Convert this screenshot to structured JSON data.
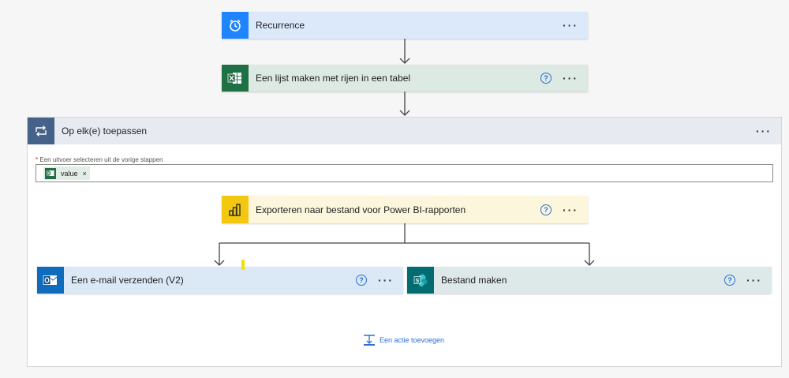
{
  "steps": {
    "recurrence": {
      "title": "Recurrence",
      "more": "···"
    },
    "list_rows": {
      "title": "Een lijst maken met rijen in een tabel",
      "help": "?",
      "more": "···"
    },
    "foreach": {
      "title": "Op elk(e) toepassen",
      "more": "···",
      "field_required_marker": "*",
      "field_label": "Een uitvoer selecteren uit de vorige stappen",
      "token_label": "value",
      "token_remove": "×",
      "export": {
        "title": "Exporteren naar bestand voor Power BI-rapporten",
        "help": "?",
        "more": "···"
      },
      "email": {
        "title": "Een e-mail verzenden (V2)",
        "help": "?",
        "more": "···"
      },
      "create_file": {
        "title": "Bestand maken",
        "help": "?",
        "more": "···"
      },
      "add_action": "Een actie toevoegen"
    }
  },
  "colors": {
    "recurrence_bg": "#dbe9fb",
    "recurrence_icon": "#1f85ff",
    "excel_bg": "#dde9e3",
    "excel_icon": "#1e7145",
    "foreach_icon": "#44628a",
    "powerbi_bg": "#fbf6dc",
    "powerbi_icon": "#f2c811",
    "outlook_bg": "#dbe9f7",
    "outlook_icon": "#0f6cbd",
    "sharepoint_bg": "#dde9e8",
    "sharepoint_icon": "#036c70",
    "link": "#2b6fd6"
  },
  "icons": {
    "recurrence": "alarm-clock-icon",
    "excel": "excel-icon",
    "foreach": "loop-icon",
    "powerbi": "powerbi-icon",
    "outlook": "outlook-icon",
    "sharepoint": "sharepoint-icon",
    "add_action": "add-step-icon"
  }
}
